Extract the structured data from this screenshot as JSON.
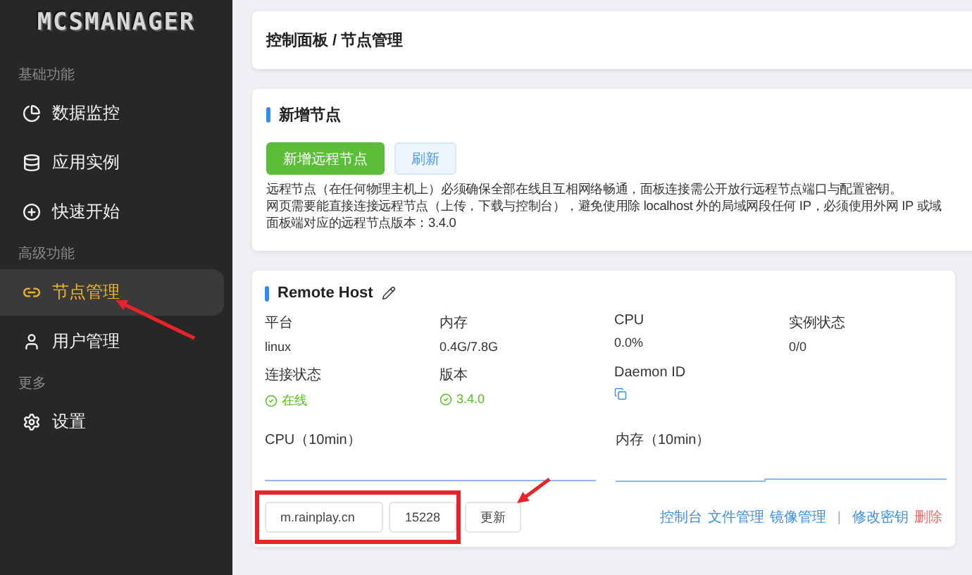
{
  "logo": "MCSMANAGER",
  "sidebar": {
    "sections": [
      {
        "title": "基础功能",
        "items": [
          {
            "label": "数据监控",
            "selected": false
          },
          {
            "label": "应用实例",
            "selected": false
          },
          {
            "label": "快速开始",
            "selected": false
          }
        ]
      },
      {
        "title": "高级功能",
        "items": [
          {
            "label": "节点管理",
            "selected": true
          },
          {
            "label": "用户管理",
            "selected": false
          }
        ]
      },
      {
        "title": "更多",
        "items": [
          {
            "label": "设置",
            "selected": false
          }
        ]
      }
    ]
  },
  "breadcrumb": "控制面板 / 节点管理",
  "add_node": {
    "title": "新增节点",
    "buttons": [
      {
        "label": "新增远程节点",
        "kind": "primary"
      },
      {
        "label": "刷新",
        "kind": "light"
      }
    ],
    "notes": [
      "远程节点（在任何物理主机上）必须确保全部在线且互相网络畅通，面板连接需公开放行远程节点端口与配置密钥。",
      "网页需要能直接连接远程节点（上传，下载与控制台），避免使用除 localhost 外的局域网段任何 IP，必须使用外网 IP 或域",
      "面板端对应的远程节点版本：3.4.0"
    ]
  },
  "node": {
    "title": "Remote Host",
    "stats": [
      {
        "label": "平台",
        "value": "linux",
        "kind": "text"
      },
      {
        "label": "内存",
        "value": "0.4G/7.8G",
        "kind": "text"
      },
      {
        "label": "CPU",
        "value": "0.0%",
        "kind": "text"
      },
      {
        "label": "实例状态",
        "value": "0/0",
        "kind": "text"
      },
      {
        "label": "连接状态",
        "value": "在线",
        "kind": "ok"
      },
      {
        "label": "版本",
        "value": "3.4.0",
        "kind": "ok"
      },
      {
        "label": "Daemon ID",
        "kind": "copy"
      }
    ],
    "charts": [
      {
        "title": "CPU（10min）"
      },
      {
        "title": "内存（10min）"
      }
    ],
    "address": "m.rainplay.cn",
    "port": "15228",
    "update": "更新",
    "links": [
      {
        "label": "控制台",
        "kind": "link"
      },
      {
        "label": "文件管理",
        "kind": "link"
      },
      {
        "label": "镜像管理",
        "kind": "link"
      },
      {
        "label": "|",
        "kind": "separator"
      },
      {
        "label": "修改密钥",
        "kind": "link"
      },
      {
        "label": "删除",
        "kind": "danger"
      }
    ]
  }
}
